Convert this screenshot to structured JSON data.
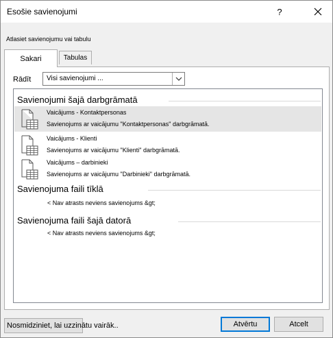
{
  "dialog": {
    "title": "Esošie savienojumi",
    "help_label": "?",
    "close_icon": "close-icon"
  },
  "instruction": "Atlasiet savienojumu vai tabulu",
  "tabs": [
    {
      "label": "Sakari",
      "active": true
    },
    {
      "label": "Tabulas",
      "active": false
    }
  ],
  "show": {
    "label": "Rādīt",
    "value": "Visi savienojumi ..."
  },
  "list": {
    "sections": [
      {
        "title": "Savienojumi šajā darbgrāmatā",
        "items": [
          {
            "name": "Vaicājums - Kontaktpersonas",
            "description": "Savienojums ar vaicājumu \"Kontaktpersonas\" darbgrāmatā.",
            "selected": true,
            "icon": "table-connection-icon"
          },
          {
            "name": "Vaicājums - Klienti",
            "description": "Savienojums ar vaicājumu \"Klienti\" darbgrāmatā.",
            "selected": false,
            "icon": "table-connection-icon"
          },
          {
            "name": "Vaicājums – darbinieki",
            "description": "Savienojums ar vaicājumu \"Darbinieki\" darbgrāmatā.",
            "selected": false,
            "icon": "table-connection-icon"
          }
        ]
      },
      {
        "title": "Savienojuma faili tīklā",
        "empty_text": "< Nav atrasts neviens savienojums &gt;"
      },
      {
        "title": "Savienojuma faili šajā datorā",
        "empty_text": "< Nav atrasts neviens savienojums &gt;"
      }
    ]
  },
  "buttons": {
    "browse": "Nosmidziniet, lai uzzinātu vairāk..",
    "open": "Atvērtu",
    "cancel": "Atcelt"
  },
  "colors": {
    "selection": "#e5e5e5",
    "default_button_border": "#0078d7"
  }
}
